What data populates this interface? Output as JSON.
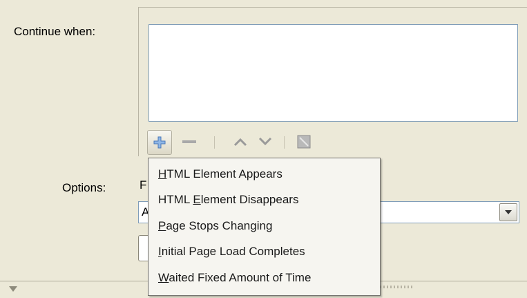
{
  "labels": {
    "continue_when": "Continue when:",
    "options": "Options:",
    "options_peek": "F"
  },
  "toolbar": {
    "add_icon": "plus-icon",
    "remove_icon": "minus-icon",
    "up_icon": "chevron-up-icon",
    "down_icon": "chevron-down-icon",
    "edit_icon": "edit-icon"
  },
  "combo": {
    "value_peek": "A"
  },
  "menu": {
    "items": [
      {
        "label": "HTML Element Appears",
        "mnemonic": "H"
      },
      {
        "label": "HTML Element Disappears",
        "mnemonic": "E"
      },
      {
        "label": "Page Stops Changing",
        "mnemonic": "P"
      },
      {
        "label": "Initial Page Load Completes",
        "mnemonic": "I"
      },
      {
        "label": "Waited Fixed Amount of Time",
        "mnemonic": "W"
      }
    ]
  },
  "colors": {
    "background": "#ece9d8",
    "field_border": "#7f9db9",
    "icon_blue": "#5b8fd0",
    "icon_gray": "#9a9a9a"
  }
}
